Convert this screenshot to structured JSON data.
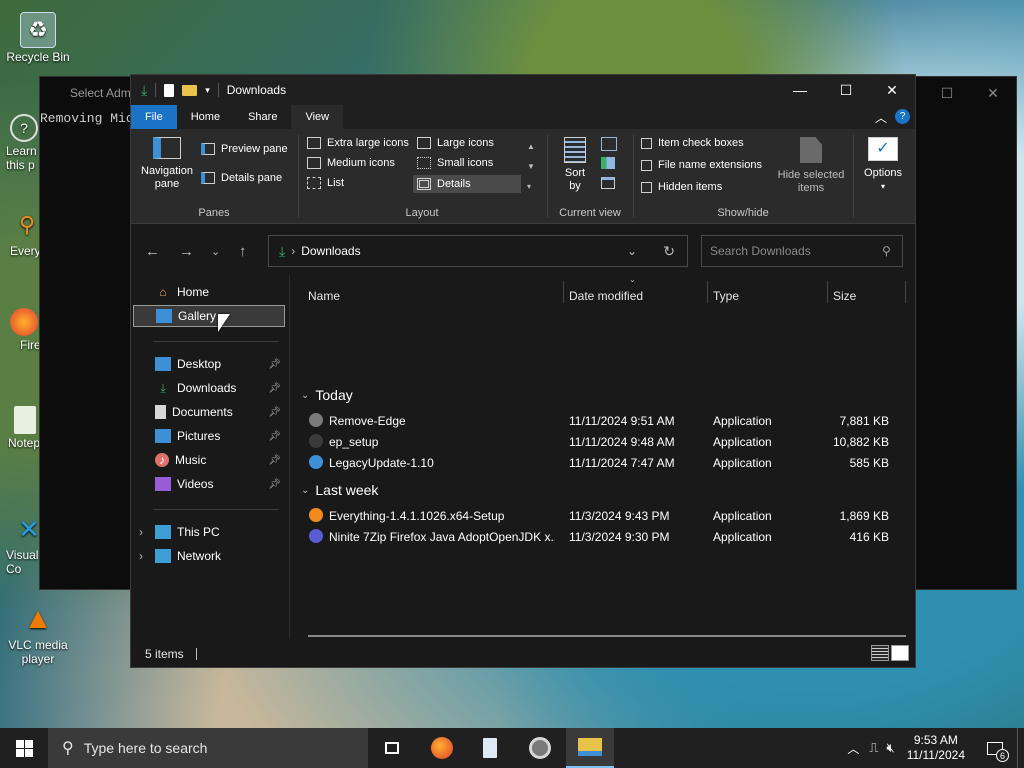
{
  "desktop": {
    "icons": [
      {
        "label": "Recycle Bin",
        "icon": "recycle-bin-icon"
      },
      {
        "label": "Learn\nthis p",
        "icon": "learn-icon"
      },
      {
        "label": "Every",
        "icon": "everything-shortcut-icon"
      },
      {
        "label": "Fire",
        "icon": "firefox-shortcut-icon"
      },
      {
        "label": "Notep",
        "icon": "notepad-shortcut-icon"
      },
      {
        "label": "Visual\nCo",
        "icon": "visual-studio-code-shortcut-icon"
      },
      {
        "label": "VLC media\nplayer",
        "icon": "vlc-icon"
      }
    ]
  },
  "terminal": {
    "title": "Select Adm",
    "text": "Removing Mic"
  },
  "explorer": {
    "title": "Downloads",
    "tabs": [
      {
        "label": "File"
      },
      {
        "label": "Home"
      },
      {
        "label": "Share"
      },
      {
        "label": "View"
      }
    ],
    "ribbon": {
      "panes": {
        "nav_pane": "Navigation\npane",
        "preview_pane": "Preview pane",
        "details_pane": "Details pane",
        "label": "Panes"
      },
      "layout": {
        "items": [
          "Extra large icons",
          "Large icons",
          "Medium icons",
          "Small icons",
          "List",
          "Details"
        ],
        "selected": "Details",
        "label": "Layout"
      },
      "current_view": {
        "sort": "Sort\nby",
        "label": "Current view"
      },
      "show_hide": {
        "item_check_boxes": "Item check boxes",
        "file_name_extensions": "File name extensions",
        "hidden_items": "Hidden items",
        "hide_selected": "Hide selected\nitems",
        "label": "Show/hide"
      },
      "options": "Options"
    },
    "address": {
      "path": "Downloads",
      "search_placeholder": "Search Downloads"
    },
    "nav": {
      "items": [
        {
          "label": "Home",
          "icon": "home-icon"
        },
        {
          "label": "Gallery",
          "icon": "gallery-icon"
        },
        {
          "label": "Desktop",
          "icon": "desktop-icon"
        },
        {
          "label": "Downloads",
          "icon": "download-icon"
        },
        {
          "label": "Documents",
          "icon": "documents-icon"
        },
        {
          "label": "Pictures",
          "icon": "pictures-icon"
        },
        {
          "label": "Music",
          "icon": "music-icon"
        },
        {
          "label": "Videos",
          "icon": "videos-icon"
        },
        {
          "label": "This PC",
          "icon": "this-pc-icon"
        },
        {
          "label": "Network",
          "icon": "network-icon"
        }
      ],
      "selected": "Gallery"
    },
    "columns": [
      "Name",
      "Date modified",
      "Type",
      "Size"
    ],
    "groups": [
      {
        "label": "Today",
        "files": [
          {
            "name": "Remove-Edge",
            "date": "11/11/2024 9:51 AM",
            "type": "Application",
            "size": "7,881 KB",
            "color": "#7a7a7a"
          },
          {
            "name": "ep_setup",
            "date": "11/11/2024 9:48 AM",
            "type": "Application",
            "size": "10,882 KB",
            "color": "#3a3a3a"
          },
          {
            "name": "LegacyUpdate-1.10",
            "date": "11/11/2024 7:47 AM",
            "type": "Application",
            "size": "585 KB",
            "color": "#3d8fd6"
          }
        ]
      },
      {
        "label": "Last week",
        "files": [
          {
            "name": "Everything-1.4.1.1026.x64-Setup",
            "date": "11/3/2024 9:43 PM",
            "type": "Application",
            "size": "1,869 KB",
            "color": "#f08a1c"
          },
          {
            "name": "Ninite 7Zip Firefox Java AdoptOpenJDK x...",
            "date": "11/3/2024 9:30 PM",
            "type": "Application",
            "size": "416 KB",
            "color": "#5b5bd6"
          }
        ]
      }
    ],
    "status": "5 items"
  },
  "taskbar": {
    "search_placeholder": "Type here to search",
    "time": "9:53 AM",
    "date": "11/11/2024",
    "notifications": "6"
  },
  "colors": {
    "accent": "#1a73c7",
    "explorer_bg": "#191919",
    "ribbon_bg": "#2b2b2b",
    "taskbar_bg": "#202020"
  }
}
